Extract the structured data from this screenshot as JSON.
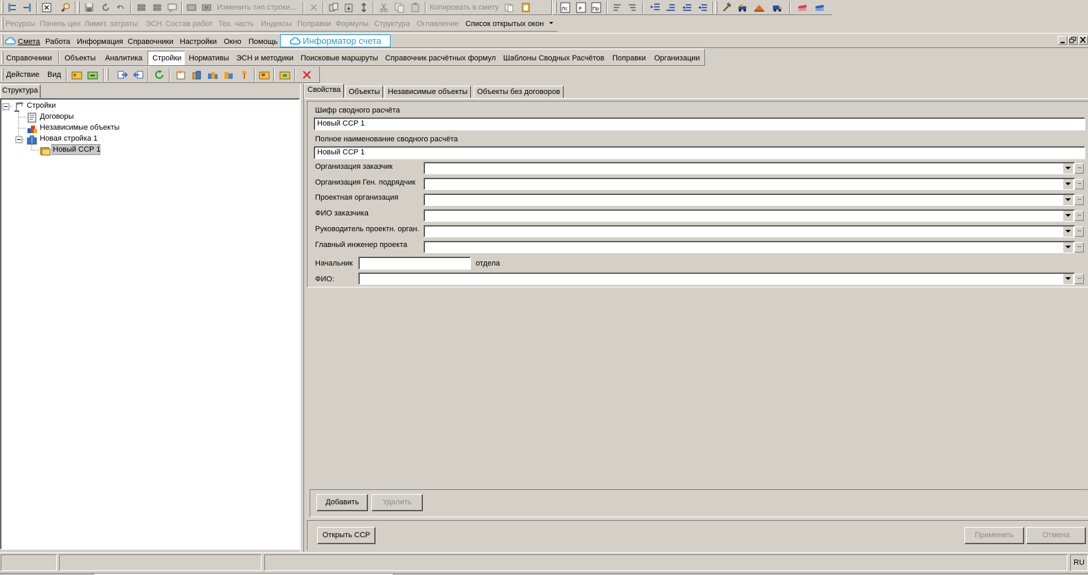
{
  "toolbar_top": {
    "change_row_type": "Изменить тип строки...",
    "copy_to_estimate": "Копировать в смету"
  },
  "toolbar_menu": {
    "items": [
      "Ресурсы",
      "Панель цен",
      "Лимит. затраты",
      "ЭСН",
      "Состав работ",
      "Тех. часть",
      "Индексы",
      "Поправки",
      "Формулы",
      "Структура",
      "Оглавление"
    ],
    "open_windows": "Список открытых окон"
  },
  "main_menu": {
    "items": [
      "Смета",
      "Работа",
      "Информация",
      "Справочники",
      "Настройки",
      "Окно",
      "Помощь"
    ],
    "informer": "Информатор счета"
  },
  "ref_menu": {
    "items": [
      "Справочники",
      "Объекты",
      "Аналитика",
      "Стройки",
      "Нормативы",
      "ЭСН и методики",
      "Поисковые маршруты",
      "Справочник расчётных формул",
      "Шаблоны Сводных Расчётов",
      "Поправки",
      "Организации"
    ],
    "active_index": 3
  },
  "action_bar": {
    "action": "Действие",
    "view": "Вид"
  },
  "left_panel": {
    "tab": "Структура",
    "tree": {
      "root": "Стройки",
      "contracts": "Договоры",
      "independent": "Независимые объекты",
      "construction": "Новая стройка 1",
      "ssr": "Новый ССР 1"
    }
  },
  "right_panel": {
    "tabs": [
      "Свойства",
      "Объекты",
      "Независимые объекты",
      "Объекты без договоров"
    ],
    "code_label": "Шифр сводного расчёта",
    "code_value": "Новый ССР 1",
    "fullname_label": "Полное наименование сводного расчёта",
    "fullname_value": "Новый ССР 1",
    "fields": [
      {
        "label": "Организация заказчик",
        "value": ""
      },
      {
        "label": "Организация Ген. подрядчик",
        "value": ""
      },
      {
        "label": "Проектная организация",
        "value": ""
      },
      {
        "label": "ФИО заказчика",
        "value": ""
      },
      {
        "label": "Руководитель проектн. орган.",
        "value": ""
      },
      {
        "label": "Главный инженер проекта",
        "value": ""
      }
    ],
    "chief_label": "Начальник",
    "chief_value": "",
    "dept_label": "отдела",
    "fio_label": "ФИО:",
    "fio_value": "",
    "add_button": "Добавить",
    "delete_button": "Удалить",
    "open_ssr_button": "Открыть ССР",
    "apply_button": "Применить",
    "cancel_button": "Отмена"
  },
  "status_bar": {
    "lang": "RU"
  },
  "colors": {
    "face": "#d4d0c8",
    "informer": "#1ea0e6",
    "selection": "#c8c8c8",
    "delete_red": "#e02020"
  }
}
